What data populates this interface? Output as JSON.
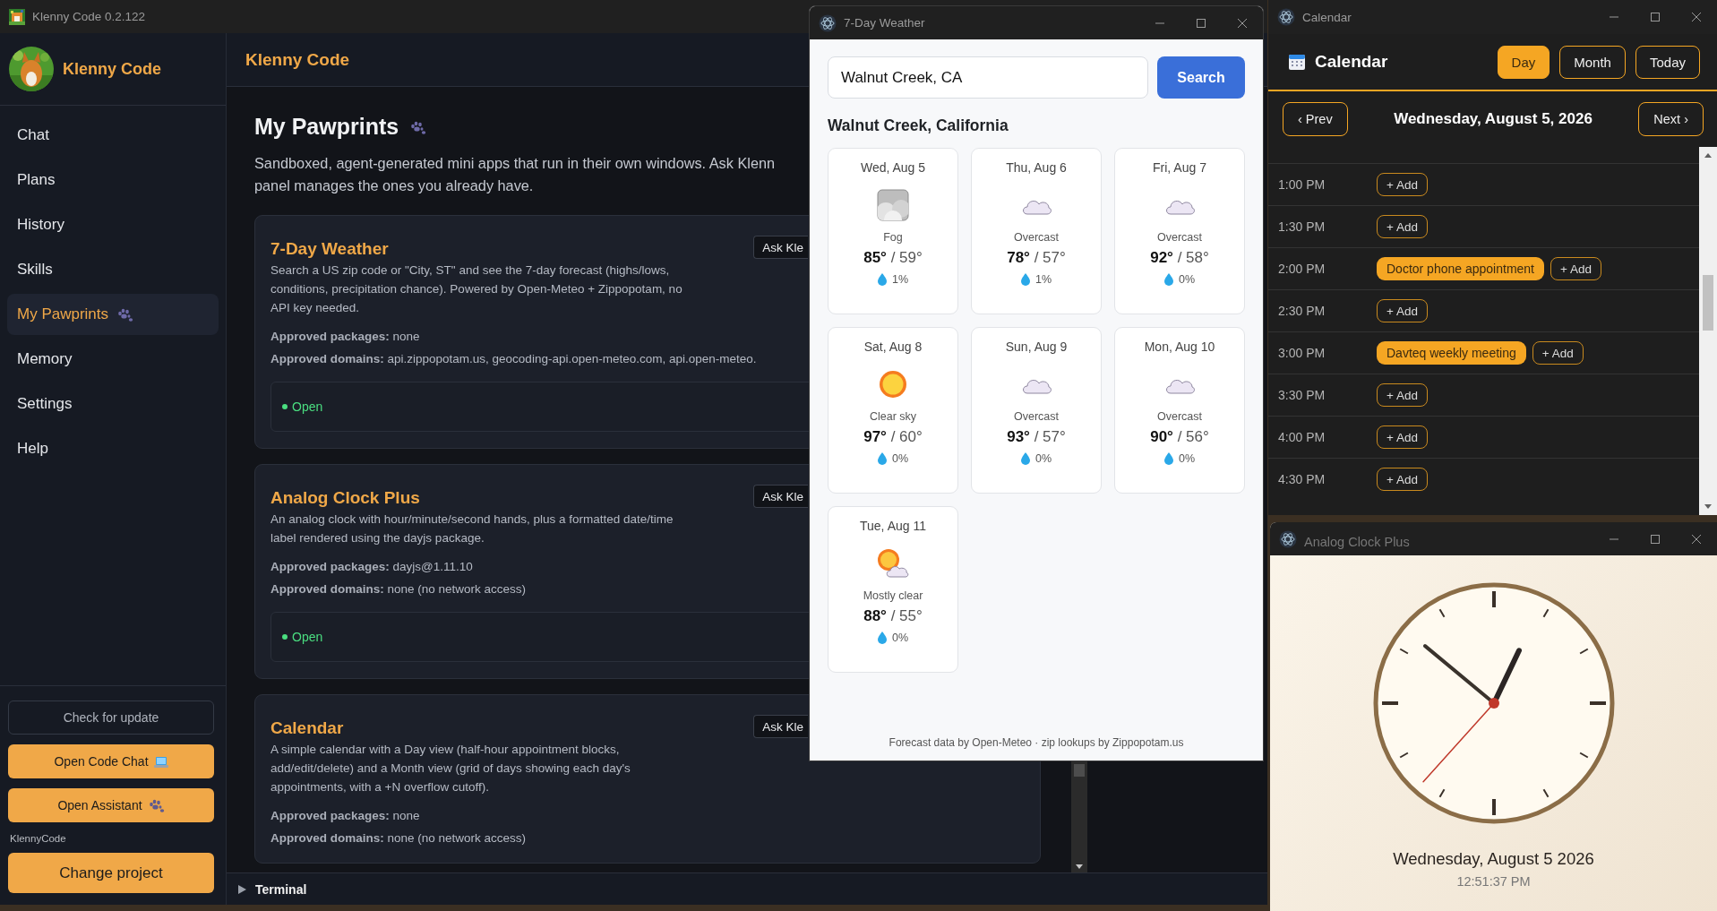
{
  "main_window": {
    "title": "Klenny Code 0.2.122"
  },
  "sidebar": {
    "brand": "Klenny Code",
    "items": [
      {
        "label": "Chat",
        "selected": false,
        "icon": false
      },
      {
        "label": "Plans",
        "selected": false,
        "icon": false
      },
      {
        "label": "History",
        "selected": false,
        "icon": false
      },
      {
        "label": "Skills",
        "selected": false,
        "icon": false
      },
      {
        "label": "My Pawprints",
        "selected": true,
        "icon": true
      },
      {
        "label": "Memory",
        "selected": false,
        "icon": false
      },
      {
        "label": "Settings",
        "selected": false,
        "icon": false
      },
      {
        "label": "Help",
        "selected": false,
        "icon": false
      }
    ],
    "update_button": "Check for update",
    "actions": [
      "Open Code Chat",
      "Open Assistant"
    ],
    "project_label": "KlennyCode",
    "change_project_button": "Change project"
  },
  "header": {
    "title": "Klenny Code"
  },
  "page": {
    "title": "My Pawprints",
    "description_lines": [
      "Sandboxed, agent-generated mini apps that run in their own windows. Ask Klenn",
      "panel manages the ones you already have."
    ],
    "apps": [
      {
        "name": "7-Day Weather",
        "description": "Search a US zip code or \"City, ST\" and see the 7-day forecast (highs/lows, conditions, precipitation chance). Powered by Open-Meteo + Zippopotam, no API key needed.",
        "packages": "**Approved packages:** none",
        "domains": "**Approved domains:** api.zippopotam.us, geocoding-api.open-meteo.com, api.open-meteo.",
        "ask_button": "Ask Kle",
        "status": "Open"
      },
      {
        "name": "Analog Clock Plus",
        "description": "An analog clock with hour/minute/second hands, plus a formatted date/time label rendered using the dayjs package.",
        "packages": "**Approved packages:** dayjs@1.11.10",
        "domains": "**Approved domains:** none (no network access)",
        "ask_button": "Ask Kle",
        "status": "Open"
      },
      {
        "name": "Calendar",
        "description": "A simple calendar with a Day view (half-hour appointment blocks, add/edit/delete) and a Month view (grid of days showing each day's appointments, with a +N overflow cutoff).",
        "packages": "**Approved packages:** none",
        "domains": "**Approved domains:** none (no network access)",
        "ask_button": "Ask Kle"
      }
    ]
  },
  "terminal": {
    "label": "Terminal",
    "expanded": false
  },
  "weather_window": {
    "title": "7-Day Weather",
    "search": {
      "value": "Walnut Creek, CA"
    },
    "search_button": "Search",
    "location": "Walnut Creek, California",
    "days": [
      {
        "day": "Wed, Aug 5",
        "kind": "fog",
        "condition": "Fog",
        "temps": "**85°** / 59°",
        "precip": "1%"
      },
      {
        "day": "Thu, Aug 6",
        "kind": "cloud",
        "condition": "Overcast",
        "temps": "**78°** / 57°",
        "precip": "1%"
      },
      {
        "day": "Fri, Aug 7",
        "kind": "cloud",
        "condition": "Overcast",
        "temps": "**92°** / 58°",
        "precip": "0%"
      },
      {
        "day": "Sat, Aug 8",
        "kind": "sun",
        "condition": "Clear sky",
        "temps": "**97°** / 60°",
        "precip": "0%"
      },
      {
        "day": "Sun, Aug 9",
        "kind": "cloud",
        "condition": "Overcast",
        "temps": "**93°** / 57°",
        "precip": "0%"
      },
      {
        "day": "Mon, Aug 10",
        "kind": "cloud",
        "condition": "Overcast",
        "temps": "**90°** / 56°",
        "precip": "0%"
      },
      {
        "day": "Tue, Aug 11",
        "kind": "partly",
        "condition": "Mostly clear",
        "temps": "**88°** / 55°",
        "precip": "0%"
      }
    ],
    "footer": "Forecast data by Open-Meteo · zip lookups by Zippopotam.us"
  },
  "calendar_window": {
    "title": "Calendar",
    "heading": "Calendar",
    "views": [
      {
        "label": "Day",
        "selected": true
      },
      {
        "label": "Month",
        "selected": false
      }
    ],
    "today_button": "Today",
    "prev_button": "‹ Prev",
    "next_button": "Next ›",
    "date": "Wednesday, August 5, 2026",
    "slots": [
      {
        "time": "1:00 PM",
        "add_button": "+ Add"
      },
      {
        "time": "1:30 PM",
        "add_button": "+ Add"
      },
      {
        "time": "2:00 PM",
        "events": [
          "Doctor phone appointment"
        ],
        "add_button": "+ Add"
      },
      {
        "time": "2:30 PM",
        "add_button": "+ Add"
      },
      {
        "time": "3:00 PM",
        "events": [
          "Davteq weekly meeting"
        ],
        "add_button": "+ Add"
      },
      {
        "time": "3:30 PM",
        "add_button": "+ Add"
      },
      {
        "time": "4:00 PM",
        "add_button": "+ Add"
      },
      {
        "time": "4:30 PM",
        "add_button": "+ Add"
      }
    ]
  },
  "clock_window": {
    "title": "Analog Clock Plus",
    "date": "Wednesday, August 5 2026",
    "time": "12:51:37 PM"
  }
}
